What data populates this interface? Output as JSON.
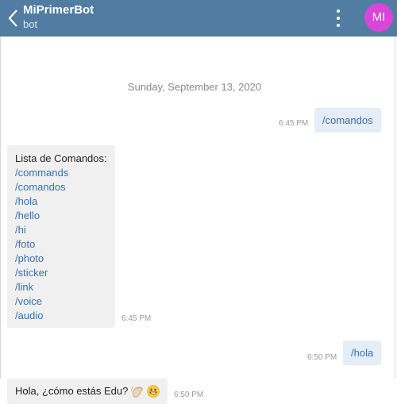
{
  "header": {
    "title": "MiPrimerBot",
    "subtitle": "bot",
    "avatar_initials": "MI",
    "avatar_color": "#d946d9",
    "bar_color": "#517da2"
  },
  "chat": {
    "date_separator": "Sunday, September 13, 2020",
    "messages": {
      "m1": {
        "text": "/comandos",
        "time": "6:45 PM"
      },
      "m2": {
        "heading": "Lista de Comandos:",
        "commands": [
          "/commands",
          "/comandos",
          "/hola",
          "/hello",
          "/hi",
          "/foto",
          "/photo",
          "/sticker",
          "/link",
          "/voice",
          "/audio"
        ],
        "time": "6:45 PM"
      },
      "m3": {
        "text": "/hola",
        "time": "6:50 PM"
      },
      "m4": {
        "text": "Hola, ¿cómo estás Edu?",
        "emojis": [
          "waving-hand",
          "grinning-face"
        ],
        "time": "6:50 PM"
      }
    }
  }
}
